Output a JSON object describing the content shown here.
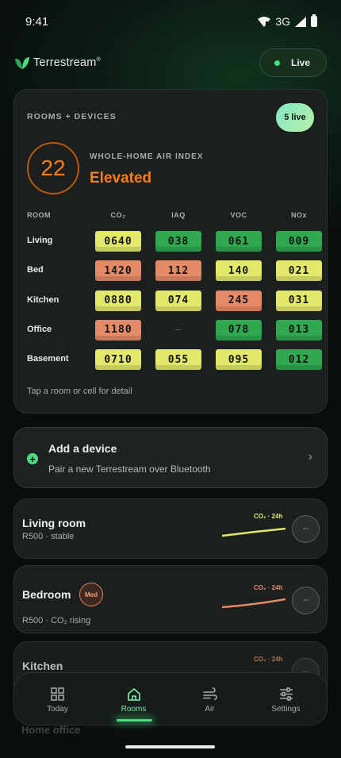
{
  "status_bar": {
    "time": "9:41",
    "network": "3G"
  },
  "app": {
    "brand": "Terrestream",
    "trademark": "®",
    "live_label": "Live",
    "accent": "#4ade80"
  },
  "rooms_devices": {
    "heading": "ROOMS + DEVICES",
    "live_count": "5 live",
    "index_value": "22",
    "index_label": "WHOLE-HOME AIR INDEX",
    "index_status": "Elevated",
    "columns": {
      "room": "ROOM",
      "co2": "CO₂",
      "iaq": "IAQ",
      "voc": "VOC",
      "nox": "NOx"
    },
    "rows": [
      {
        "name": "Living",
        "co2": "0640",
        "iaq": "038",
        "voc": "061",
        "nox": "009",
        "levels": [
          "mod",
          "good",
          "good",
          "good"
        ]
      },
      {
        "name": "Bed",
        "co2": "1420",
        "iaq": "112",
        "voc": "140",
        "nox": "021",
        "levels": [
          "high",
          "high",
          "mod",
          "mod"
        ]
      },
      {
        "name": "Kitchen",
        "co2": "0880",
        "iaq": "074",
        "voc": "245",
        "nox": "031",
        "levels": [
          "mod",
          "mod",
          "high",
          "mod"
        ]
      },
      {
        "name": "Office",
        "co2": "1180",
        "iaq": "–",
        "voc": "078",
        "nox": "013",
        "levels": [
          "high",
          "none",
          "good",
          "good"
        ]
      },
      {
        "name": "Basement",
        "co2": "0710",
        "iaq": "055",
        "voc": "095",
        "nox": "012",
        "levels": [
          "mod",
          "mod",
          "mod",
          "good"
        ]
      }
    ],
    "hint": "Tap a room or cell for detail",
    "level_colors": {
      "good": "#2fa84f",
      "mod": "#e2e86a",
      "high": "#e58a66"
    }
  },
  "add_device": {
    "title": "Add a device",
    "subtitle": "Pair a new Terrestream over Bluetooth",
    "icon": "plus-circle-icon"
  },
  "room_cards": [
    {
      "name": "Living room",
      "sub": "R500 · stable",
      "spark_label": "CO₂ · 24h",
      "button": "--",
      "color": "#e2e86a"
    },
    {
      "name": "Bedroom",
      "badge": "Med",
      "sub": "R500 · CO₂ rising",
      "spark_label": "CO₂ · 24h",
      "button": "--",
      "color": "#e58a66"
    },
    {
      "name": "Kitchen",
      "spark_label": "CO₂ · 24h",
      "button": "--",
      "color": "#e58a66"
    },
    {
      "name": "Home office"
    }
  ],
  "nav": {
    "items": [
      {
        "label": "Today",
        "icon": "grid-icon"
      },
      {
        "label": "Rooms",
        "icon": "home-icon"
      },
      {
        "label": "Air",
        "icon": "wind-icon"
      },
      {
        "label": "Settings",
        "icon": "sliders-icon"
      }
    ],
    "active": "Rooms"
  }
}
